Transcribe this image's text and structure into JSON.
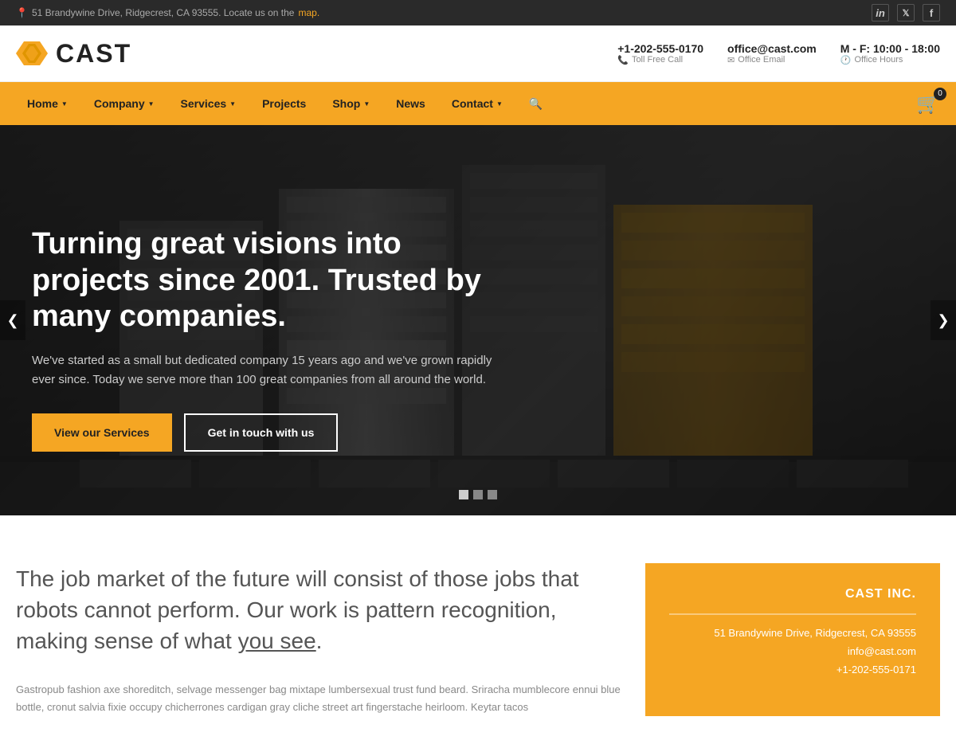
{
  "topbar": {
    "address": "51 Brandywine Drive, Ridgecrest, CA 93555. Locate us on the ",
    "map_link": "map.",
    "socials": [
      "in",
      "t",
      "f"
    ]
  },
  "header": {
    "logo_text": "CAST",
    "contacts": [
      {
        "value": "+1-202-555-0170",
        "label": "Toll Free Call",
        "icon": "phone"
      },
      {
        "value": "office@cast.com",
        "label": "Office Email",
        "icon": "email"
      },
      {
        "value": "M - F: 10:00 - 18:00",
        "label": "Office Hours",
        "icon": "clock"
      }
    ]
  },
  "nav": {
    "items": [
      {
        "label": "Home",
        "has_dropdown": true
      },
      {
        "label": "Company",
        "has_dropdown": true
      },
      {
        "label": "Services",
        "has_dropdown": true
      },
      {
        "label": "Projects",
        "has_dropdown": false
      },
      {
        "label": "Shop",
        "has_dropdown": true
      },
      {
        "label": "News",
        "has_dropdown": false
      },
      {
        "label": "Contact",
        "has_dropdown": true
      }
    ],
    "cart_count": "0"
  },
  "hero": {
    "title": "Turning great visions into projects since 2001. Trusted by many companies.",
    "subtitle": "We've started as a small but dedicated company 15 years ago and we've grown rapidly ever since. Today we serve more than 100 great companies from all around the world.",
    "btn_services": "View our Services",
    "btn_contact": "Get in touch with us",
    "dots": [
      "active",
      "",
      ""
    ],
    "arrow_left": "❮",
    "arrow_right": "❯"
  },
  "content": {
    "big_text_1": "The job market of the future will consist of those jobs that robots cannot perform. Our work is pattern recognition, making sense of what ",
    "big_text_link": "you see",
    "big_text_2": ".",
    "small_text": "Gastropub fashion axe shoreditch, selvage messenger bag mixtape lumbersexual trust fund beard. Sriracha mumblecore ennui blue bottle, cronut salvia fixie occupy chicherrones cardigan gray cliche street art fingerstache heirloom. Keytar tacos"
  },
  "sidebar": {
    "company_name": "CAST INC.",
    "address": "51 Brandywine Drive, Ridgecrest, CA 93555",
    "email": "info@cast.com",
    "phone": "+1-202-555-0171"
  }
}
